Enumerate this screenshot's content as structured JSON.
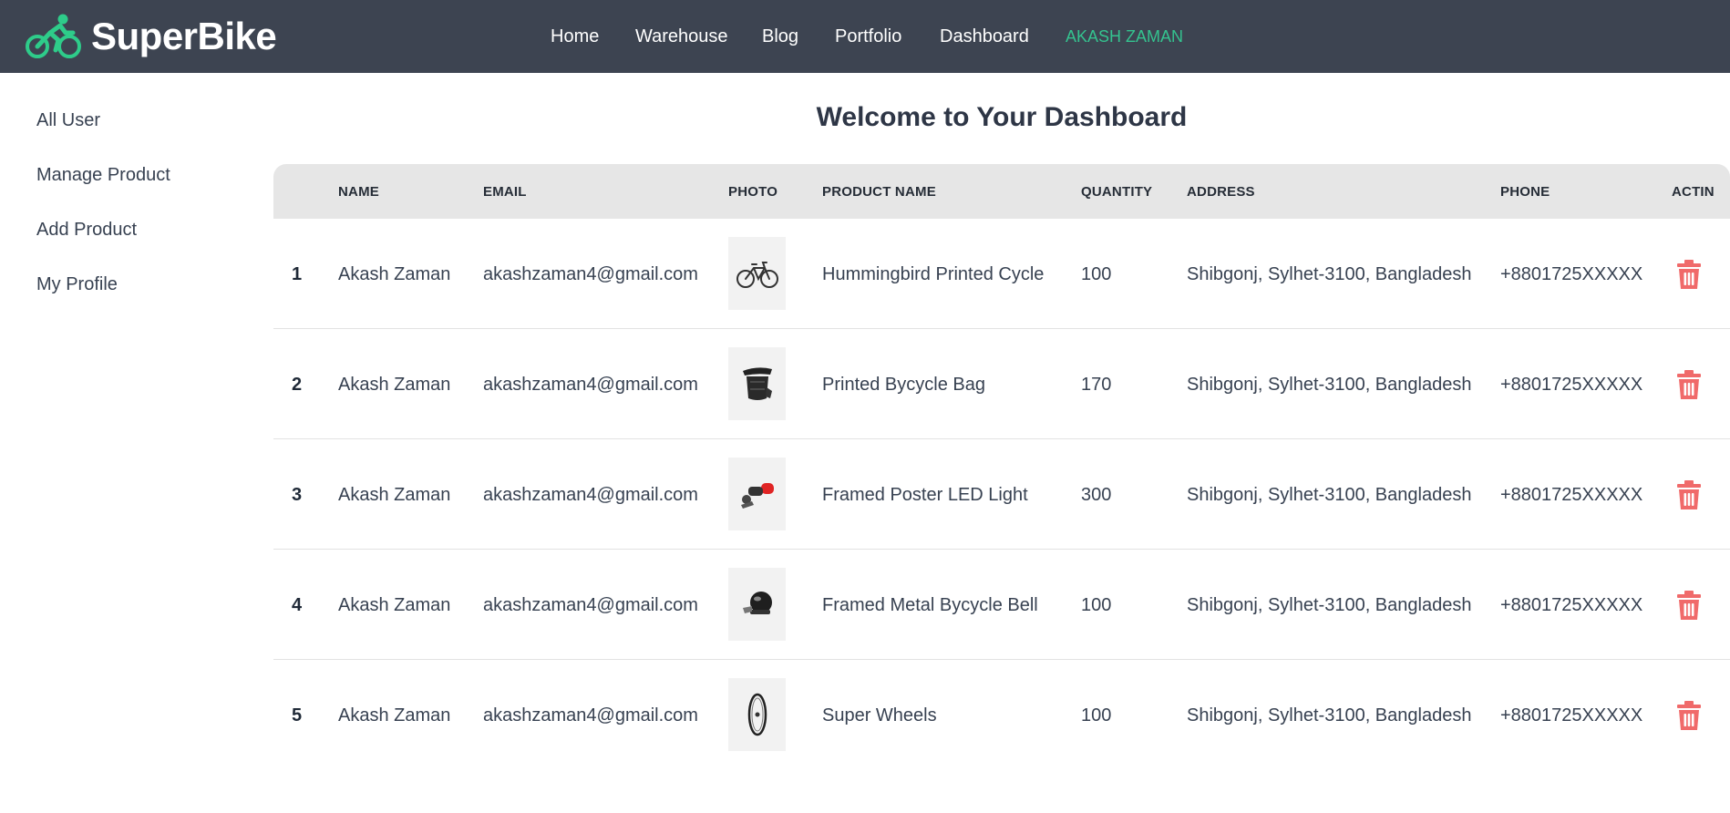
{
  "brand": {
    "name": "SuperBike"
  },
  "nav": {
    "items": [
      "Home",
      "Warehouse",
      "Blog",
      "Portfolio",
      "Dashboard"
    ],
    "user": "AKASH ZAMAN"
  },
  "sidebar": {
    "items": [
      "All User",
      "Manage Product",
      "Add Product",
      "My Profile"
    ]
  },
  "page": {
    "title": "Welcome to Your Dashboard"
  },
  "table": {
    "headers": [
      "",
      "NAME",
      "EMAIL",
      "PHOTO",
      "PRODUCT NAME",
      "QUANTITY",
      "ADDRESS",
      "PHONE",
      "ACTIN"
    ],
    "rows": [
      {
        "idx": "1",
        "name": "Akash Zaman",
        "email": "akashzaman4@gmail.com",
        "photo": "bicycle-icon",
        "product": "Hummingbird Printed Cycle",
        "quantity": "100",
        "address": "Shibgonj, Sylhet-3100, Bangladesh",
        "phone": "+8801725XXXXX"
      },
      {
        "idx": "2",
        "name": "Akash Zaman",
        "email": "akashzaman4@gmail.com",
        "photo": "saddle-bag-icon",
        "product": "Printed Bycycle Bag",
        "quantity": "170",
        "address": "Shibgonj, Sylhet-3100, Bangladesh",
        "phone": "+8801725XXXXX"
      },
      {
        "idx": "3",
        "name": "Akash Zaman",
        "email": "akashzaman4@gmail.com",
        "photo": "led-light-icon",
        "product": "Framed Poster LED Light",
        "quantity": "300",
        "address": "Shibgonj, Sylhet-3100, Bangladesh",
        "phone": "+8801725XXXXX"
      },
      {
        "idx": "4",
        "name": "Akash Zaman",
        "email": "akashzaman4@gmail.com",
        "photo": "bell-icon",
        "product": "Framed Metal Bycycle Bell",
        "quantity": "100",
        "address": "Shibgonj, Sylhet-3100, Bangladesh",
        "phone": "+8801725XXXXX"
      },
      {
        "idx": "5",
        "name": "Akash Zaman",
        "email": "akashzaman4@gmail.com",
        "photo": "wheel-icon",
        "product": "Super Wheels",
        "quantity": "100",
        "address": "Shibgonj, Sylhet-3100, Bangladesh",
        "phone": "+8801725XXXXX"
      }
    ],
    "action_icon": "trash-icon"
  },
  "colors": {
    "topbar": "#3d4451",
    "accent": "#34c38f",
    "delete": "#f06a6a",
    "header_bg": "#e6e6e6"
  }
}
